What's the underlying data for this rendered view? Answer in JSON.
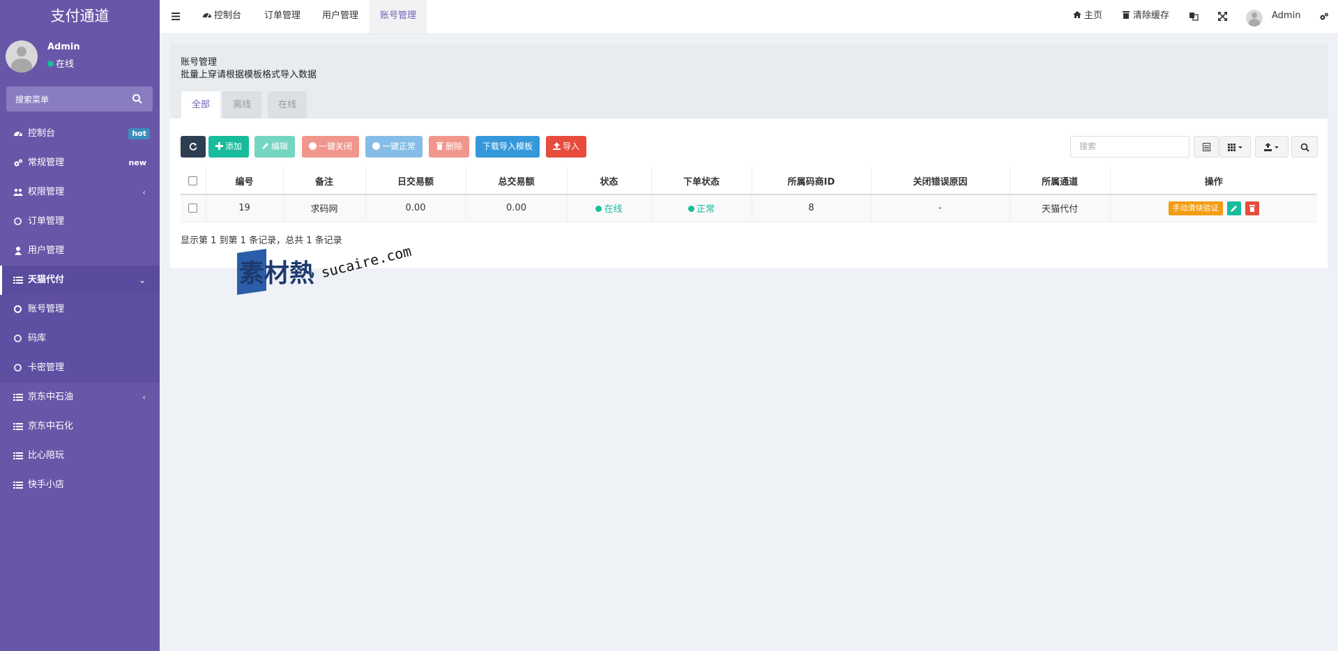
{
  "app": {
    "title": "支付通道"
  },
  "user": {
    "name": "Admin",
    "status": "在线"
  },
  "sidebar": {
    "search_placeholder": "搜索菜单",
    "items": [
      {
        "label": "控制台",
        "icon": "dashboard-icon",
        "badge": "hot"
      },
      {
        "label": "常规管理",
        "icon": "cogs-icon",
        "badge": "new"
      },
      {
        "label": "权限管理",
        "icon": "group-icon",
        "chevron": "‹"
      },
      {
        "label": "订单管理",
        "icon": "circle-icon"
      },
      {
        "label": "用户管理",
        "icon": "user-icon"
      },
      {
        "label": "天猫代付",
        "icon": "list-icon",
        "chevron": "⌄"
      },
      {
        "label": "账号管理",
        "icon": "circle-icon"
      },
      {
        "label": "码库",
        "icon": "circle-icon"
      },
      {
        "label": "卡密管理",
        "icon": "circle-icon"
      },
      {
        "label": "京东中石油",
        "icon": "list-icon",
        "chevron": "‹"
      },
      {
        "label": "京东中石化",
        "icon": "list-icon"
      },
      {
        "label": "比心陪玩",
        "icon": "list-icon"
      },
      {
        "label": "快手小店",
        "icon": "list-icon"
      }
    ]
  },
  "topbar": {
    "tabs": [
      "控制台",
      "订单管理",
      "用户管理",
      "账号管理"
    ],
    "home": "主页",
    "clear_cache": "清除缓存",
    "admin": "Admin"
  },
  "panel": {
    "title": "账号管理",
    "subtitle": "批量上穿请根据模板格式导入数据",
    "tabs": [
      "全部",
      "离线",
      "在线"
    ]
  },
  "toolbar": {
    "add": "添加",
    "edit": "编辑",
    "close_all": "一键关闭",
    "normal_all": "一键正常",
    "delete": "删除",
    "download_template": "下载导入模板",
    "import": "导入",
    "search_placeholder": "搜索"
  },
  "table": {
    "columns": [
      "编号",
      "备注",
      "日交易额",
      "总交易额",
      "状态",
      "下单状态",
      "所属码商ID",
      "关闭错误原因",
      "所属通道",
      "操作"
    ],
    "rows": [
      {
        "id": "19",
        "note": "求码网",
        "daily": "0.00",
        "total": "0.00",
        "status": "在线",
        "order_status": "正常",
        "merchant_id": "8",
        "reason": "-",
        "channel": "天猫代付",
        "action": "手动滑块验证"
      }
    ],
    "summary": "显示第 1 到第 1 条记录，总共 1 条记录"
  },
  "watermark": {
    "text": "素材熱",
    "url": "sucaire.com"
  },
  "colors": {
    "sidebar": "#6857a8",
    "accent": "#6f5fb5",
    "success": "#18bc9c",
    "danger": "#e74c3c",
    "warning": "#f39c12",
    "primary": "#3498db"
  }
}
